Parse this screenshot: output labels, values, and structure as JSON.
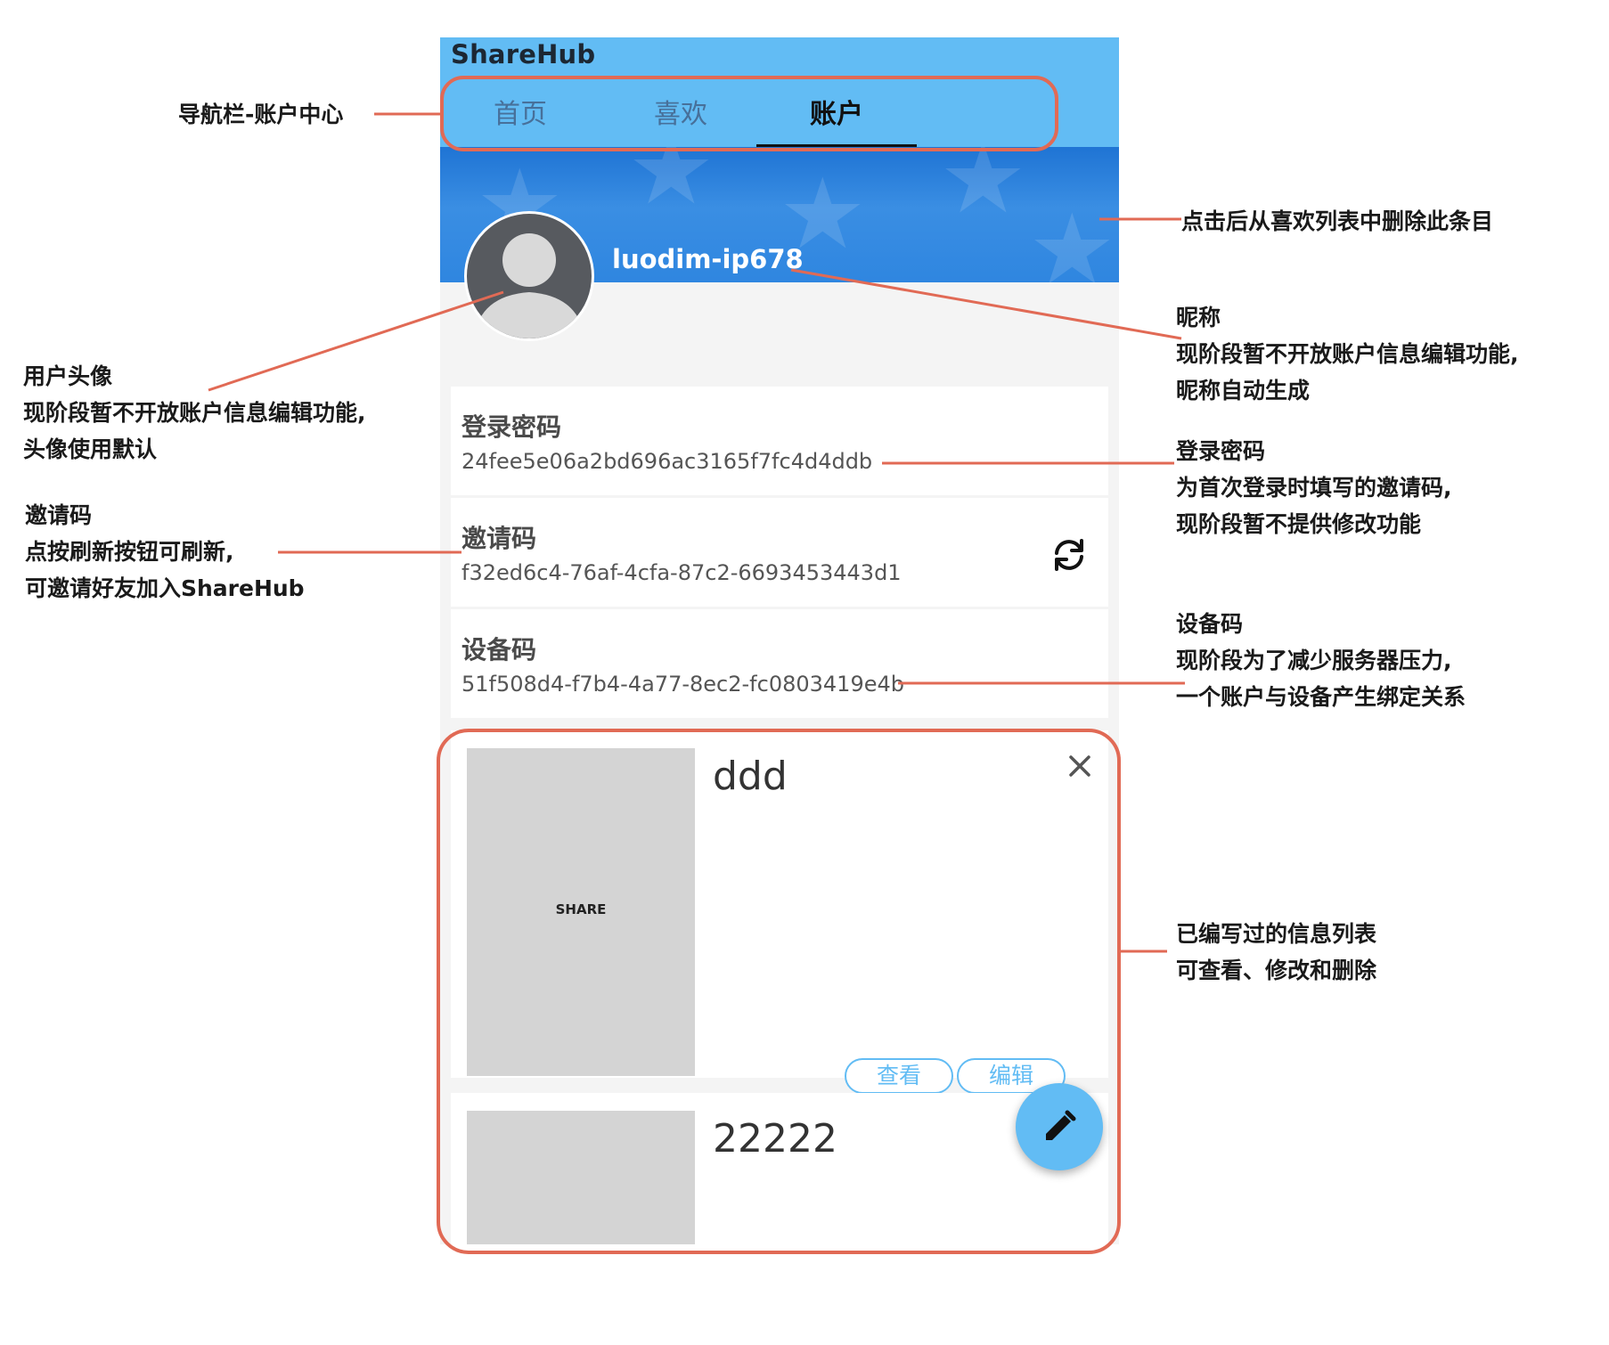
{
  "app": {
    "title": "ShareHub",
    "tabs": [
      {
        "label": "首页",
        "active": false
      },
      {
        "label": "喜欢",
        "active": false
      },
      {
        "label": "账户",
        "active": true
      }
    ],
    "accent_color": "#62bcf4"
  },
  "profile": {
    "nickname": "luodim-ip678",
    "avatar_icon": "default-user-avatar"
  },
  "info": {
    "password": {
      "title": "登录密码",
      "value": "24fee5e06a2bd696ac3165f7fc4d4ddb"
    },
    "invite": {
      "title": "邀请码",
      "value": "f32ed6c4-76af-4cfa-87c2-6693453443d1",
      "icon": "refresh-icon"
    },
    "device": {
      "title": "设备码",
      "value": "51f508d4-f7b4-4a77-8ec2-fc0803419e4b"
    }
  },
  "shares": [
    {
      "title": "ddd",
      "thumb_label": "SHARE",
      "view_label": "查看",
      "edit_label": "编辑"
    },
    {
      "title": "22222",
      "thumb_label": ""
    }
  ],
  "fab_icon": "pencil-icon",
  "annotations": {
    "nav": "导航栏-账户中心",
    "delete": "点击后从喜欢列表中删除此条目",
    "nickname": [
      "昵称",
      "现阶段暂不开放账户信息编辑功能,",
      "昵称自动生成"
    ],
    "avatar": [
      "用户头像",
      "现阶段暂不开放账户信息编辑功能,",
      "头像使用默认"
    ],
    "invite": [
      "邀请码",
      "点按刷新按钮可刷新,",
      "可邀请好友加入ShareHub"
    ],
    "password": [
      "登录密码",
      "为首次登录时填写的邀请码,",
      "现阶段暂不提供修改功能"
    ],
    "device": [
      "设备码",
      "现阶段为了减少服务器压力,",
      "一个账户与设备产生绑定关系"
    ],
    "list": [
      "已编写过的信息列表",
      "可查看、修改和删除"
    ]
  },
  "annotation_color": "#e16a55"
}
